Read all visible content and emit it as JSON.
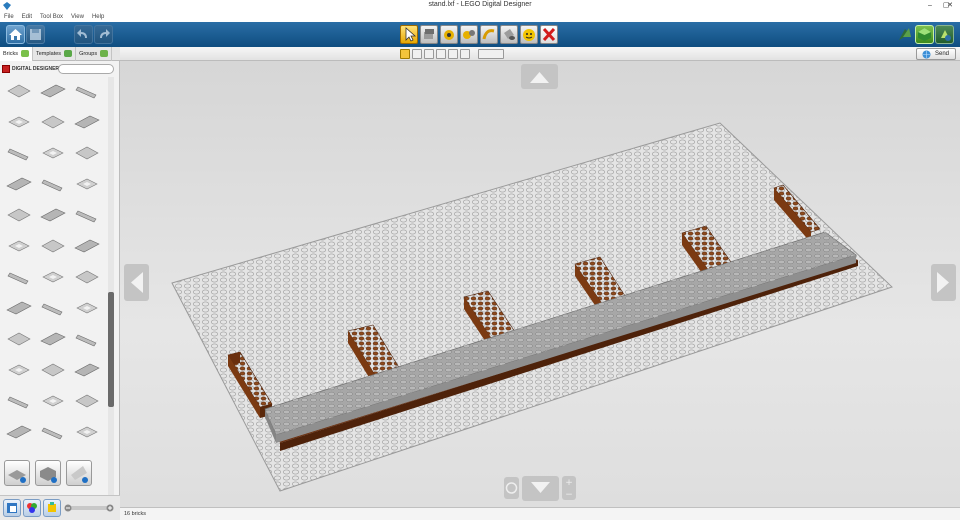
{
  "window": {
    "title": "stand.lxf - LEGO Digital Designer",
    "controls": [
      "minimize-icon",
      "maximize-icon",
      "close-icon"
    ]
  },
  "menu": [
    "File",
    "Edit",
    "Tool Box",
    "View",
    "Help"
  ],
  "toolbar": {
    "left": [
      "home-icon",
      "save-icon",
      "undo-icon",
      "redo-icon"
    ],
    "tools": [
      {
        "name": "select-tool",
        "active": true
      },
      {
        "name": "clone-tool"
      },
      {
        "name": "hinge-tool"
      },
      {
        "name": "hinge-align-tool"
      },
      {
        "name": "flex-tool"
      },
      {
        "name": "paint-tool"
      },
      {
        "name": "decoration-tool"
      },
      {
        "name": "delete-tool"
      }
    ],
    "modes": [
      "build-mode",
      "view-mode",
      "building-guide-mode"
    ]
  },
  "subbar": {
    "send_label": "Send",
    "selection_icons": [
      "single-select",
      "multi-select",
      "connected-select",
      "same-color-select",
      "same-brick-select",
      "invert-select"
    ]
  },
  "palette": {
    "tabs": [
      {
        "label": "Bricks",
        "color": "#6cbf3b"
      },
      {
        "label": "Templates",
        "color": "#6cbf3b"
      },
      {
        "label": "Groups",
        "color": "#6cbf3b"
      }
    ],
    "brand": "DIGITAL DESIGNER",
    "search_placeholder": "",
    "brick_rows": 12,
    "brick_cols": 3
  },
  "status": {
    "bricks_text": "16 bricks"
  },
  "colors": {
    "toolbar": "#1a5a8f",
    "brick_brown": "#7b3a12",
    "brick_gray": "#a3a3a3",
    "baseplate": "#e2e2e2"
  }
}
